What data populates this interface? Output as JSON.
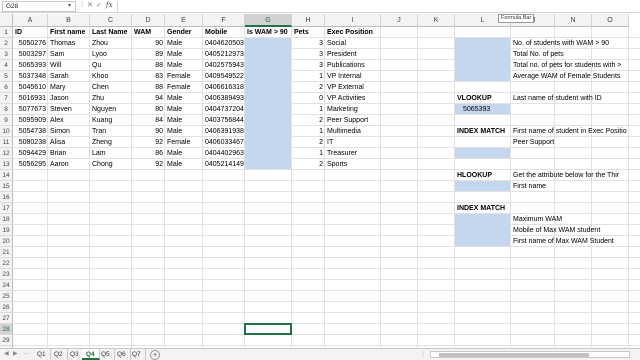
{
  "formula_bar": {
    "name_box": "G28",
    "fx_label": "fx",
    "cancel_glyph": "✕",
    "enter_glyph": "✓",
    "tooltip": "Formula Bar"
  },
  "columns": [
    "A",
    "B",
    "C",
    "D",
    "E",
    "F",
    "G",
    "H",
    "I",
    "J",
    "K",
    "L",
    "M",
    "N",
    "O"
  ],
  "selected_column": "G",
  "rows": [
    "1",
    "2",
    "3",
    "4",
    "5",
    "6",
    "7",
    "8",
    "9",
    "10",
    "11",
    "12",
    "13",
    "14",
    "15",
    "16",
    "17",
    "18",
    "19",
    "20",
    "21",
    "22",
    "23",
    "24",
    "25",
    "26",
    "27",
    "28",
    "29",
    "30"
  ],
  "selected_row": "28",
  "headers": {
    "id": "ID",
    "first_name": "First name",
    "last_name": "Last Name",
    "wam": "WAM",
    "gender": "Gender",
    "mobile": "Mobile",
    "is_wam": "Is WAM > 90",
    "pets": "Pets",
    "exec": "Exec Position"
  },
  "students": [
    {
      "id": "5050276",
      "first": "Thomas",
      "last": "Zhou",
      "wam": "90",
      "gender": "Male",
      "mobile": "0404620503",
      "pets": "3",
      "exec": "Social"
    },
    {
      "id": "5003297",
      "first": "Sam",
      "last": "Lyoo",
      "wam": "89",
      "gender": "Male",
      "mobile": "0405212973",
      "pets": "3",
      "exec": "President"
    },
    {
      "id": "5065393",
      "first": "Will",
      "last": "Qu",
      "wam": "88",
      "gender": "Male",
      "mobile": "0402575943",
      "pets": "3",
      "exec": "Publications"
    },
    {
      "id": "5037348",
      "first": "Sarah",
      "last": "Khoo",
      "wam": "83",
      "gender": "Female",
      "mobile": "0409549522",
      "pets": "1",
      "exec": "VP Internal"
    },
    {
      "id": "5045610",
      "first": "Mary",
      "last": "Chen",
      "wam": "88",
      "gender": "Female",
      "mobile": "0406616318",
      "pets": "2",
      "exec": "VP External"
    },
    {
      "id": "5016931",
      "first": "Jason",
      "last": "Zhu",
      "wam": "94",
      "gender": "Male",
      "mobile": "0406389493",
      "pets": "0",
      "exec": "VP Activities"
    },
    {
      "id": "5077673",
      "first": "Steven",
      "last": "Nguyen",
      "wam": "80",
      "gender": "Male",
      "mobile": "0404737204",
      "pets": "1",
      "exec": "Marketing"
    },
    {
      "id": "5095909",
      "first": "Alex",
      "last": "Kuang",
      "wam": "84",
      "gender": "Male",
      "mobile": "0403756844",
      "pets": "2",
      "exec": "Peer Support"
    },
    {
      "id": "5054738",
      "first": "Simon",
      "last": "Tran",
      "wam": "90",
      "gender": "Male",
      "mobile": "0406391938",
      "pets": "1",
      "exec": "Multimedia"
    },
    {
      "id": "5080238",
      "first": "Alisa",
      "last": "Zheng",
      "wam": "92",
      "gender": "Female",
      "mobile": "0406033467",
      "pets": "2",
      "exec": "IT"
    },
    {
      "id": "5094429",
      "first": "Brian",
      "last": "Lam",
      "wam": "86",
      "gender": "Male",
      "mobile": "0404402963",
      "pets": "1",
      "exec": "Treasurer"
    },
    {
      "id": "5056295",
      "first": "Aaron",
      "last": "Chong",
      "wam": "92",
      "gender": "Male",
      "mobile": "0405214149",
      "pets": "2",
      "exec": "Sports"
    }
  ],
  "side": {
    "q1": "No. of students with WAM > 90",
    "q2": "Total No. of pets",
    "q3": "Total no. of pets for students with >",
    "q4": "Average WAM of Female Students",
    "vlookup_title": "VLOOKUP",
    "vlookup_q": "Last name of student with ID",
    "vlookup_id": "5065393",
    "im1_title": "INDEX MATCH",
    "im1_q": "First name of student in Exec Positio",
    "im1_val": "Peer Support",
    "hlookup_title": "HLOOKUP",
    "hlookup_q": "Get the attribute below for the Thir",
    "hlookup_val": "First name",
    "im2_title": "INDEX MATCH",
    "im2_q1": "Maximum WAM",
    "im2_q2": "Mobile of Max WAM student",
    "im2_q3": "First name of Max WAM Student"
  },
  "sheet_tabs": [
    "Q1",
    "Q2",
    "Q3",
    "Q4",
    "Q5",
    "Q6",
    "Q7"
  ],
  "active_tab": "Q4",
  "tab_nav": {
    "prev": "◀",
    "next": "▶",
    "more": "...",
    "add": "+"
  },
  "colors": {
    "accent": "#217346",
    "highlight_fill": "#c5d7ef"
  }
}
